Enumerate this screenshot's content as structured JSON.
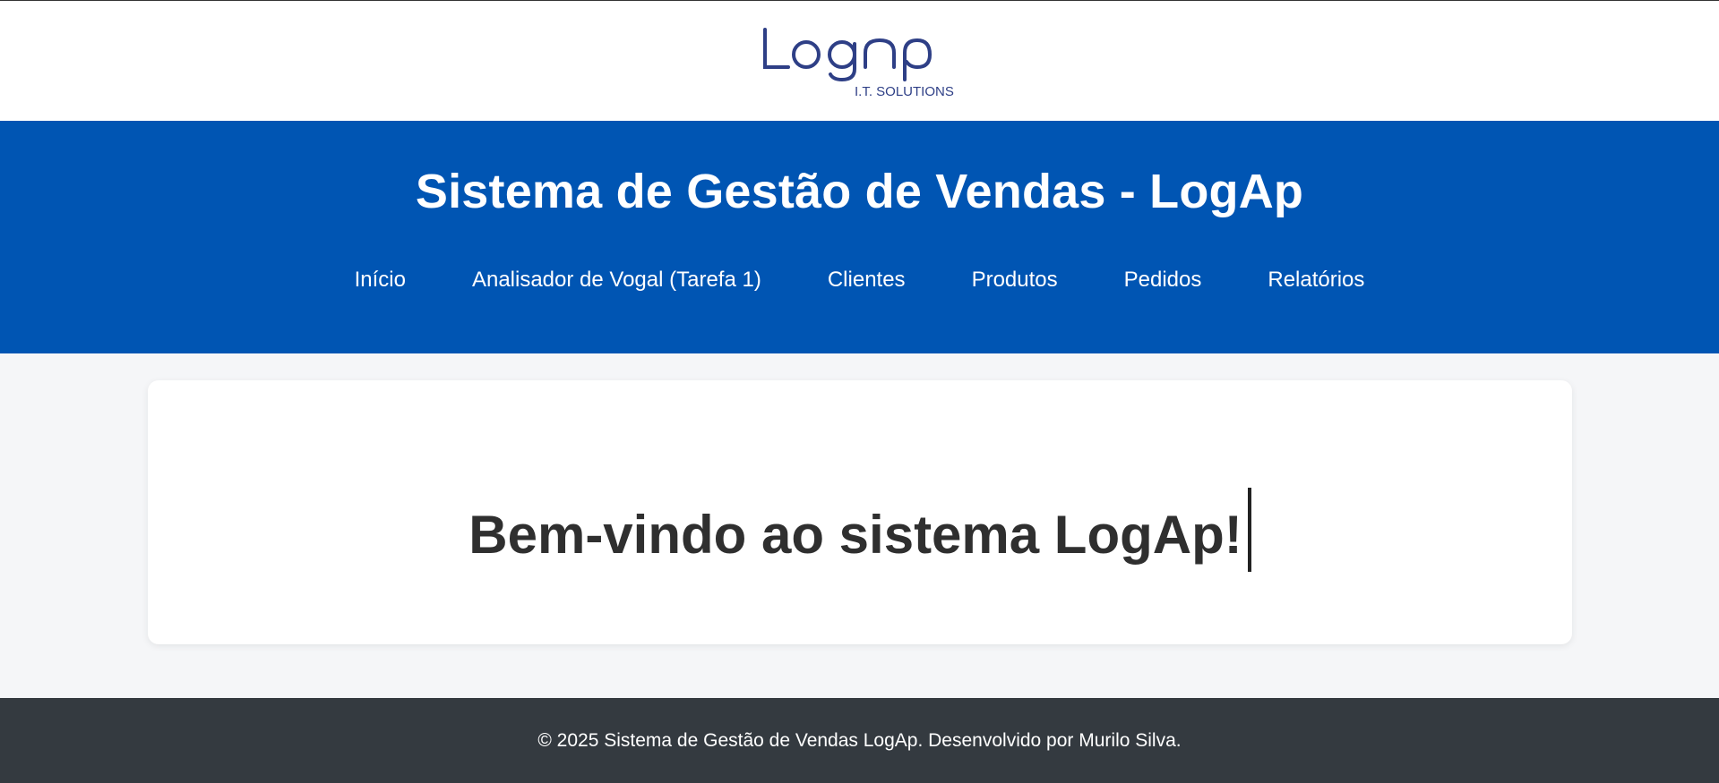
{
  "logo": {
    "name": "LogAp",
    "tagline": "I.T. SOLUTIONS",
    "color": "#2e3f86"
  },
  "header": {
    "title": "Sistema de Gestão de Vendas - LogAp",
    "background": "#0055b3"
  },
  "nav": {
    "items": [
      {
        "label": "Início"
      },
      {
        "label": "Analisador de Vogal (Tarefa 1)"
      },
      {
        "label": "Clientes"
      },
      {
        "label": "Produtos"
      },
      {
        "label": "Pedidos"
      },
      {
        "label": "Relatórios"
      }
    ]
  },
  "main": {
    "welcome": "Bem-vindo ao sistema LogAp!"
  },
  "footer": {
    "text": "© 2025 Sistema de Gestão de Vendas LogAp. Desenvolvido por Murilo Silva.",
    "background": "#343a40"
  }
}
